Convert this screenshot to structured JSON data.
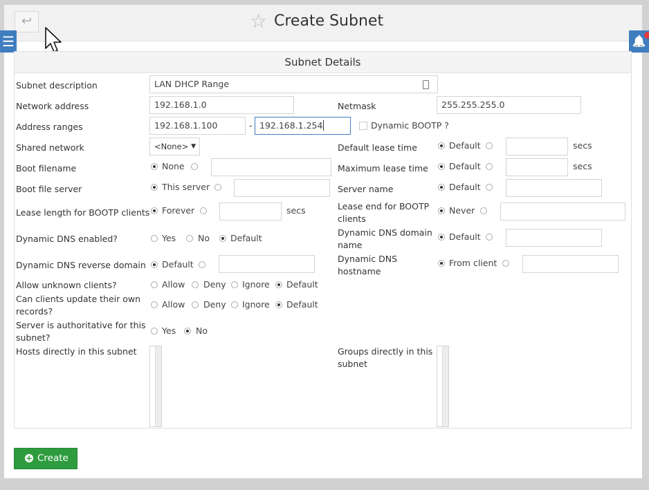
{
  "header": {
    "back_symbol": "↩",
    "star_symbol": "☆",
    "title": "Create Subnet",
    "menu_symbol": "☰",
    "bell_symbol": "🔔"
  },
  "section_title": "Subnet Details",
  "fields": {
    "subnet_description": {
      "label": "Subnet description",
      "value": "LAN DHCP Range"
    },
    "network_address": {
      "label": "Network address",
      "value": "192.168.1.0"
    },
    "netmask": {
      "label": "Netmask",
      "value": "255.255.255.0"
    },
    "address_ranges": {
      "label": "Address ranges",
      "from": "192.168.1.100",
      "separator": "-",
      "to": "192.168.1.254",
      "dynamic_bootp_label": "Dynamic BOOTP ?"
    },
    "shared_network": {
      "label": "Shared network",
      "value": "<None>"
    },
    "default_lease_time": {
      "label": "Default lease time",
      "option_default": "Default",
      "unit": "secs"
    },
    "boot_filename": {
      "label": "Boot filename",
      "option_none": "None"
    },
    "maximum_lease_time": {
      "label": "Maximum lease time",
      "option_default": "Default",
      "unit": "secs"
    },
    "boot_file_server": {
      "label": "Boot file server",
      "option_this_server": "This server"
    },
    "server_name": {
      "label": "Server name",
      "option_default": "Default"
    },
    "lease_length_bootp": {
      "label": "Lease length for BOOTP clients",
      "option_forever": "Forever",
      "unit": "secs"
    },
    "lease_end_bootp": {
      "label_line1": "Lease end for BOOTP",
      "label_line2": "clients",
      "option_never": "Never"
    },
    "dynamic_dns_enabled": {
      "label": "Dynamic DNS enabled?",
      "options": [
        "Yes",
        "No",
        "Default"
      ],
      "selected": "Default"
    },
    "dynamic_dns_domain": {
      "label_line1": "Dynamic DNS domain",
      "label_line2": "name",
      "option_default": "Default"
    },
    "dynamic_dns_reverse": {
      "label": "Dynamic DNS reverse domain",
      "option_default": "Default"
    },
    "dynamic_dns_hostname": {
      "label_line1": "Dynamic DNS",
      "label_line2": "hostname",
      "option_from_client": "From client"
    },
    "allow_unknown_clients": {
      "label": "Allow unknown clients?",
      "options": [
        "Allow",
        "Deny",
        "Ignore",
        "Default"
      ],
      "selected": "Default"
    },
    "clients_update_records": {
      "label_line1": "Can clients update their own",
      "label_line2": "records?",
      "options": [
        "Allow",
        "Deny",
        "Ignore",
        "Default"
      ],
      "selected": "Default"
    },
    "server_authoritative": {
      "label_line1": "Server is authoritative for this",
      "label_line2": "subnet?",
      "options": [
        "Yes",
        "No"
      ],
      "selected": "No"
    },
    "hosts_in_subnet": {
      "label": "Hosts directly in this subnet"
    },
    "groups_in_subnet": {
      "label_line1": "Groups directly in this",
      "label_line2": "subnet"
    }
  },
  "create_button": {
    "label": "Create",
    "icon": "+"
  },
  "colors": {
    "primary_blue": "#3f7dbf",
    "create_green": "#2e9c3e",
    "badge_red": "#e23b3b"
  }
}
